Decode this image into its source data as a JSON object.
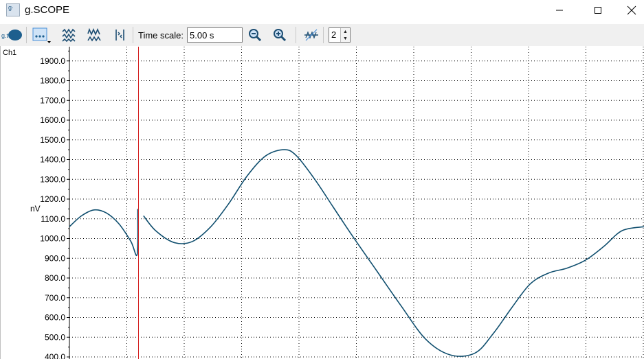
{
  "window": {
    "title": "g.SCOPE",
    "icon_text": "g·"
  },
  "toolbar": {
    "logo_text": "g.tec",
    "time_scale_label": "Time scale:",
    "time_scale_value": "5.00 s",
    "channel_spin_value": "2",
    "buttons": [
      "menu-dots",
      "waveform-view-1",
      "waveform-view-2",
      "marker-view",
      "zoom-out",
      "zoom-in",
      "filter"
    ]
  },
  "scope": {
    "channel_label": "Ch1",
    "unit_label": "nV",
    "y_tick_labels": [
      "1900.0",
      "1800.0",
      "1700.0",
      "1600.0",
      "1500.0",
      "1400.0",
      "1300.0",
      "1200.0",
      "1100.0",
      "1000.0",
      "900.0",
      "800.0",
      "700.0",
      "600.0",
      "500.0",
      "400.0"
    ],
    "colors": {
      "trace": "#0f4e6e",
      "cursor": "#d32020",
      "grid": "#000000"
    }
  },
  "chart_data": {
    "type": "line",
    "ylabel": "nV",
    "ylim": [
      400,
      1950
    ],
    "grid": true,
    "time_scale_s": 5.0,
    "sweep_cursor_t": 0.12,
    "x": [
      0,
      0.021,
      0.043,
      0.064,
      0.086,
      0.107,
      0.118,
      0.119,
      0.129,
      0.15,
      0.182,
      0.214,
      0.246,
      0.278,
      0.31,
      0.342,
      0.374,
      0.395,
      0.427,
      0.459,
      0.491,
      0.534,
      0.577,
      0.62,
      0.663,
      0.706,
      0.738,
      0.77,
      0.802,
      0.834,
      0.866,
      0.898,
      0.93,
      0.962,
      1.0
    ],
    "series": [
      {
        "values": [
          1060,
          1115,
          1145,
          1130,
          1075,
          985,
          920,
          1150,
          1115,
          1040,
          980,
          985,
          1060,
          1180,
          1320,
          1420,
          1450,
          1420,
          1300,
          1160,
          1020,
          840,
          660,
          490,
          410,
          420,
          520,
          650,
          770,
          825,
          850,
          890,
          960,
          1040,
          1060
        ]
      }
    ]
  }
}
